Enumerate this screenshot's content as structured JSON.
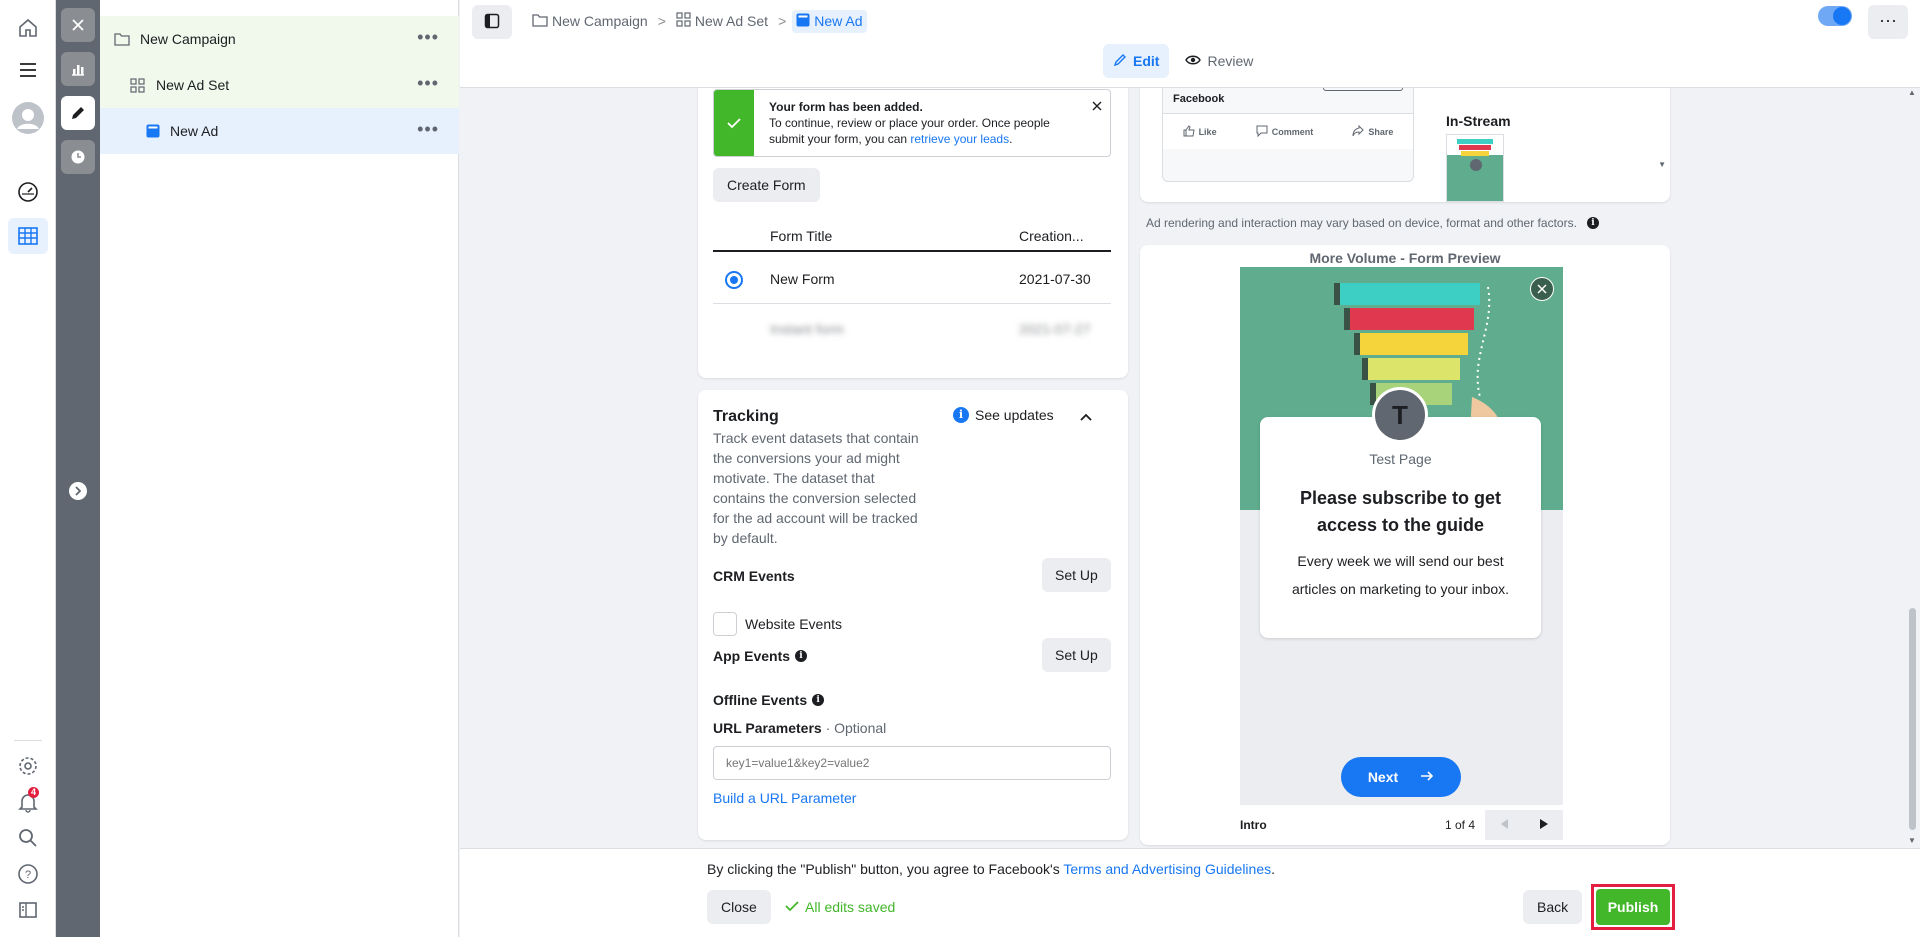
{
  "rail": {
    "icons": [
      "home-icon",
      "menu-icon",
      "avatar-icon",
      "dashboard-gauge-icon",
      "table-grid-icon",
      "settings-icon",
      "notifications-icon",
      "search-icon",
      "help-icon",
      "sidebar-layout-icon"
    ],
    "notification_count": "4",
    "accent": "#1877f2"
  },
  "strip": {
    "icons": [
      "close-icon",
      "bar-chart-icon",
      "pencil-icon",
      "clock-icon",
      "chevron-right-icon"
    ]
  },
  "tree": {
    "campaign": "New Campaign",
    "adset": "New Ad Set",
    "ad": "New Ad",
    "more": "•••"
  },
  "breadcrumb": {
    "campaign": "New Campaign",
    "adset": "New Ad Set",
    "ad": "New Ad",
    "sep": ">"
  },
  "modes": {
    "edit": "Edit",
    "review": "Review"
  },
  "topbar": {
    "more": "···"
  },
  "form_card": {
    "notice_title": "Your form has been added.",
    "notice_text": "To continue, review or place your order. Once people submit your form, you can ",
    "notice_link": "retrieve your leads",
    "notice_end": ".",
    "create_form": "Create Form",
    "col_title": "Form Title",
    "col_created": "Creation...",
    "row1_title": "New Form",
    "row1_date": "2021-07-30",
    "row2_title": "Instant form",
    "row2_date": "2021-07-27"
  },
  "tracking": {
    "title": "Tracking",
    "description": "Track event datasets that contain the conversions your ad might motivate. The dataset that contains the conversion selected for the ad account will be tracked by default.",
    "see_updates": "See updates",
    "crm_events": "CRM Events",
    "set_up": "Set Up",
    "website_events": "Website Events",
    "app_events": "App Events",
    "offline_events": "Offline Events",
    "url_params": "URL Parameters",
    "optional": " · Optional",
    "url_placeholder": "key1=value1&key2=value2",
    "build_link": "Build a URL Parameter"
  },
  "preview": {
    "fb_name": "Facebook",
    "like": "Like",
    "comment": "Comment",
    "share": "Share",
    "instream": "In-Stream",
    "disclaimer": "Ad rendering and interaction may vary based on device, format and other factors.",
    "form_preview_title": "More Volume - Form Preview",
    "avatar_letter": "T",
    "page_name": "Test Page",
    "headline": "Please subscribe to get access to the guide",
    "body": "Every week we will send our best articles on marketing to your inbox.",
    "next": "Next",
    "step_label": "Intro",
    "step_count": "1 of 4"
  },
  "footer": {
    "agree_text": "By clicking the \"Publish\" button, you agree to Facebook's ",
    "agree_link": "Terms and Advertising Guidelines",
    "agree_end": ".",
    "close": "Close",
    "saved": "All edits saved",
    "back": "Back",
    "publish": "Publish",
    "publish_color": "#42b72a",
    "highlight_color": "#e41e3f"
  }
}
